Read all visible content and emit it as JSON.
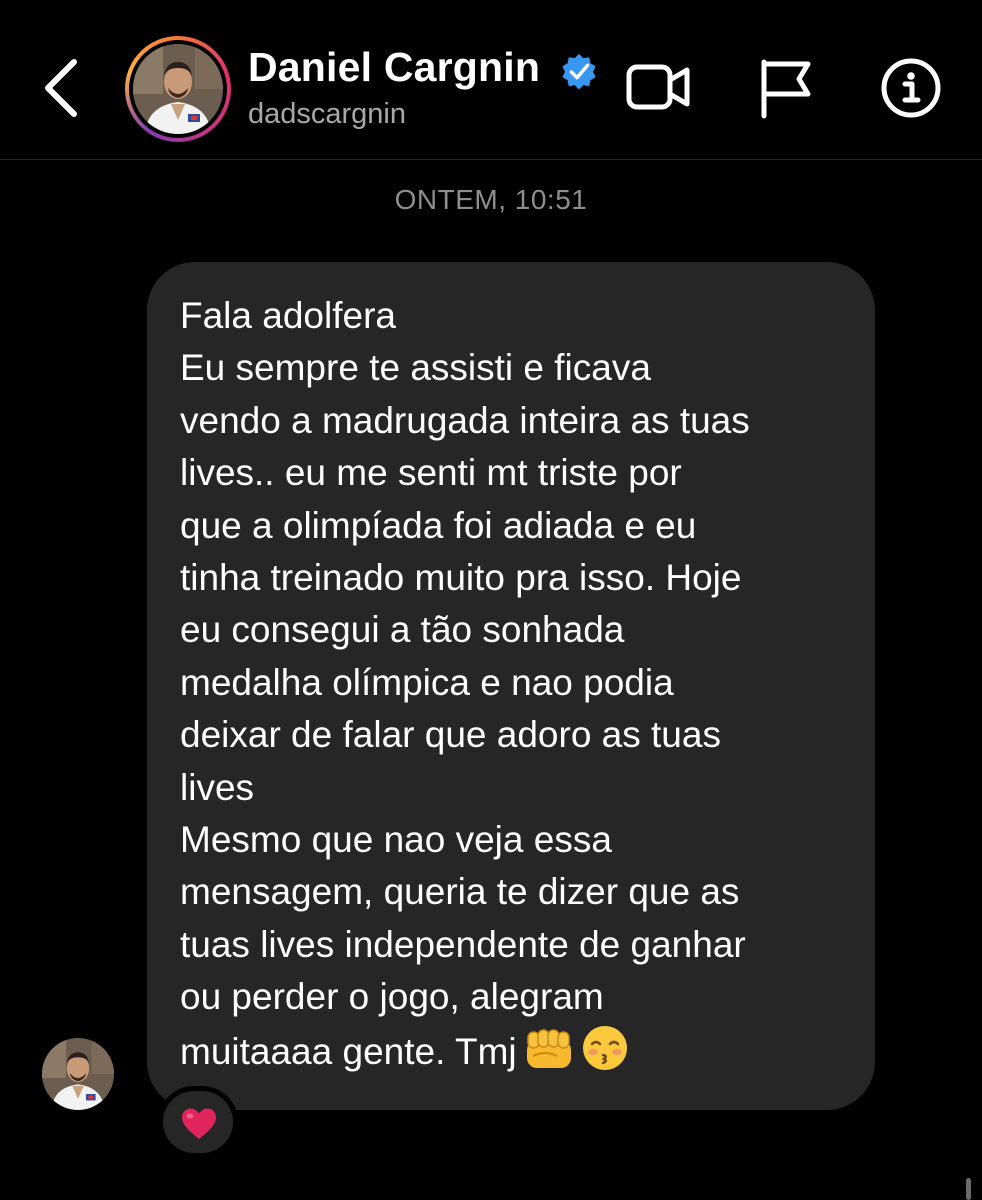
{
  "header": {
    "name": "Daniel Cargnin",
    "handle": "dadscargnin",
    "verified": true,
    "icons": [
      "back-chevron-icon",
      "video-camera-icon",
      "flag-icon",
      "info-icon",
      "verified-badge-icon"
    ]
  },
  "thread": {
    "timestamp": "ONTEM, 10:51",
    "message": {
      "lines": [
        "Fala adolfera",
        "Eu sempre te assisti e ficava\nvendo a madrugada inteira as tuas\nlives.. eu me senti mt triste por\nque a olimpíada foi adiada e eu\ntinha treinado muito pra isso. Hoje\neu consegui a tão sonhada\nmedalha olímpica e nao podia\ndeixar de falar que adoro as tuas\nlives",
        "Mesmo que nao veja essa\nmensagem, queria te dizer que as\ntuas lives independente de ganhar\nou perder o jogo, alegram\nmuitaaaa gente. Tmj"
      ],
      "emojis": [
        "oncoming-fist-emoji",
        "kissing-face-emoji"
      ],
      "reaction": "red-heart-emoji"
    }
  },
  "colors": {
    "background": "#000000",
    "bubble": "#262626",
    "verified": "#3897f0",
    "heart": "#e0245e",
    "muted_text": "#8e8e8e"
  }
}
